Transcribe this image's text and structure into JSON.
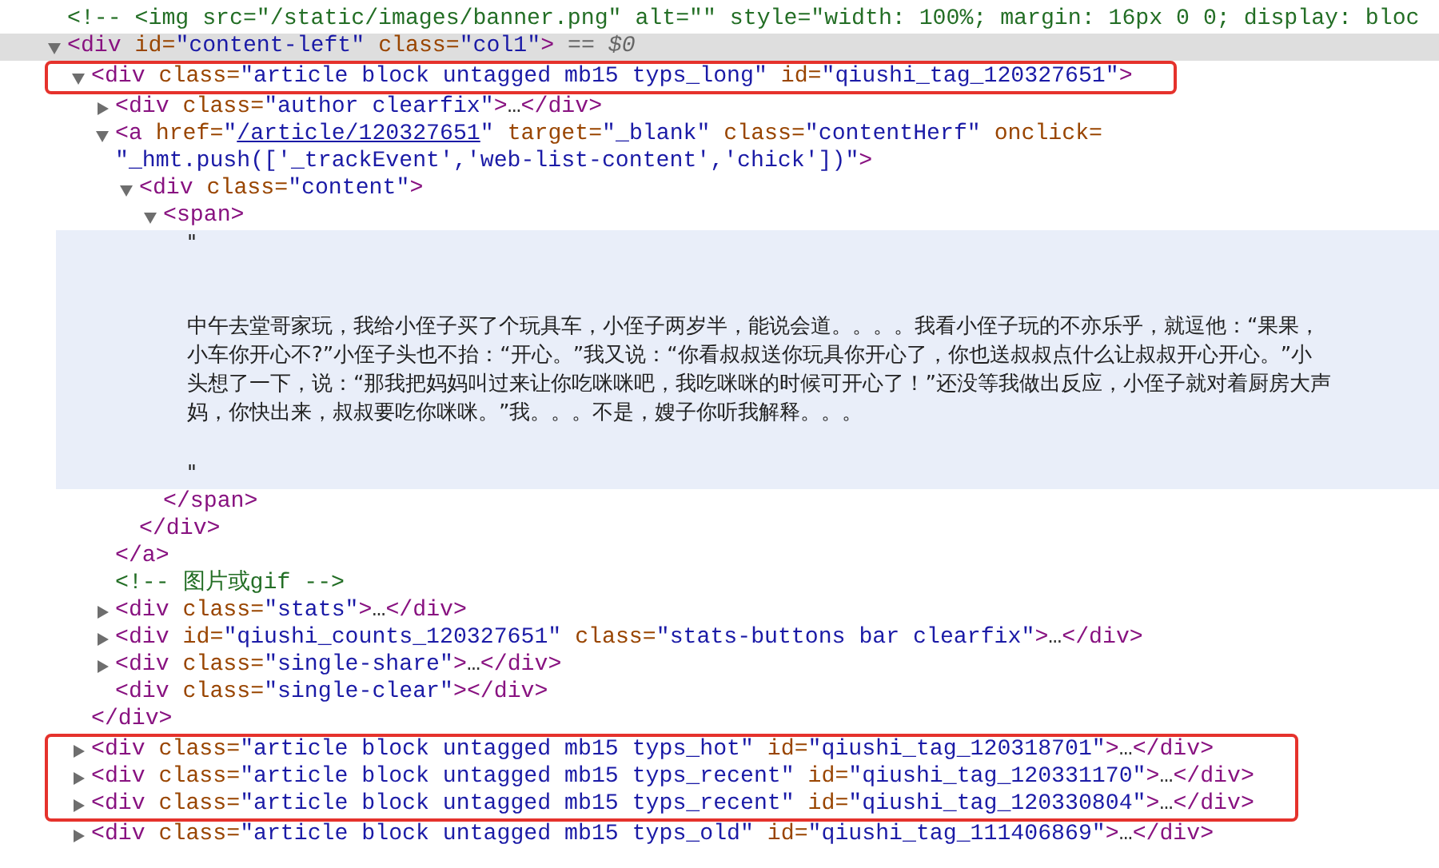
{
  "dom_tree": {
    "nodes": [
      {
        "kind": "comment",
        "selected": false,
        "outlined": false,
        "hovered": false,
        "lines": [
          [
            {
              "kind": "comment",
              "text": "<!-- <img src=\"/static/images/banner.png\" alt=\"\" style=\"width: 100%; margin: 16px 0 0; display: bloc"
            }
          ]
        ]
      },
      {
        "kind": "element",
        "expanded": true,
        "selected": true,
        "outlined": false,
        "hovered": false,
        "lines": [
          [
            {
              "kind": "tag",
              "text": "<div"
            },
            {
              "kind": "attr",
              "text": " id="
            },
            {
              "kind": "value",
              "text": "\"content-left\""
            },
            {
              "kind": "attr",
              "text": " class="
            },
            {
              "kind": "value",
              "text": "\"col1\""
            },
            {
              "kind": "tag",
              "text": ">"
            },
            {
              "kind": "marker",
              "text": " == $0"
            }
          ]
        ],
        "children": [
          {
            "kind": "element",
            "expanded": true,
            "selected": false,
            "outlined": true,
            "hovered": false,
            "lines": [
              [
                {
                  "kind": "tag",
                  "text": "<div"
                },
                {
                  "kind": "attr",
                  "text": " class="
                },
                {
                  "kind": "value",
                  "text": "\"article block untagged mb15 typs_long\""
                },
                {
                  "kind": "attr",
                  "text": " id="
                },
                {
                  "kind": "value",
                  "text": "\"qiushi_tag_120327651\""
                },
                {
                  "kind": "tag",
                  "text": ">"
                }
              ]
            ],
            "close": [
              [
                {
                  "kind": "tag",
                  "text": "</div>"
                }
              ]
            ],
            "children": [
              {
                "kind": "element",
                "expanded": false,
                "selected": false,
                "outlined": false,
                "hovered": false,
                "lines": [
                  [
                    {
                      "kind": "tag",
                      "text": "<div"
                    },
                    {
                      "kind": "attr",
                      "text": " class="
                    },
                    {
                      "kind": "value",
                      "text": "\"author clearfix\""
                    },
                    {
                      "kind": "tag",
                      "text": ">"
                    },
                    {
                      "kind": "ellipsis",
                      "text": "…"
                    },
                    {
                      "kind": "tag",
                      "text": "</div>"
                    }
                  ]
                ]
              },
              {
                "kind": "element",
                "expanded": true,
                "selected": false,
                "outlined": false,
                "hovered": false,
                "lines": [
                  [
                    {
                      "kind": "tag",
                      "text": "<a"
                    },
                    {
                      "kind": "attr",
                      "text": " href="
                    },
                    {
                      "kind": "value",
                      "text": "\""
                    },
                    {
                      "kind": "link",
                      "text": "/article/120327651"
                    },
                    {
                      "kind": "value",
                      "text": "\""
                    },
                    {
                      "kind": "attr",
                      "text": " target="
                    },
                    {
                      "kind": "value",
                      "text": "\"_blank\""
                    },
                    {
                      "kind": "attr",
                      "text": " class="
                    },
                    {
                      "kind": "value",
                      "text": "\"contentHerf\""
                    },
                    {
                      "kind": "attr",
                      "text": " onclick="
                    }
                  ],
                  [
                    {
                      "kind": "value",
                      "text": "\"_hmt.push(['_trackEvent','web-list-content','chick'])\""
                    },
                    {
                      "kind": "tag",
                      "text": ">"
                    }
                  ]
                ],
                "close": [
                  [
                    {
                      "kind": "tag",
                      "text": "</a>"
                    }
                  ]
                ],
                "children": [
                  {
                    "kind": "element",
                    "expanded": true,
                    "selected": false,
                    "outlined": false,
                    "hovered": false,
                    "lines": [
                      [
                        {
                          "kind": "tag",
                          "text": "<div"
                        },
                        {
                          "kind": "attr",
                          "text": " class="
                        },
                        {
                          "kind": "value",
                          "text": "\"content\""
                        },
                        {
                          "kind": "tag",
                          "text": ">"
                        }
                      ]
                    ],
                    "close": [
                      [
                        {
                          "kind": "tag",
                          "text": "</div>"
                        }
                      ]
                    ],
                    "children": [
                      {
                        "kind": "element",
                        "expanded": true,
                        "selected": false,
                        "outlined": false,
                        "hovered": false,
                        "lines": [
                          [
                            {
                              "kind": "tag",
                              "text": "<span>"
                            }
                          ]
                        ],
                        "close": [
                          [
                            {
                              "kind": "tag",
                              "text": "</span>"
                            }
                          ]
                        ],
                        "children": [
                          {
                            "kind": "text",
                            "selected": false,
                            "outlined": false,
                            "hovered": true,
                            "lines": [
                              "\"",
                              "中午去堂哥家玩，我给小侄子买了个玩具车，小侄子两岁半，能说会道。。。。我看小侄子玩的不亦乐乎，就逗他：“果果，",
                              "小车你开心不?”小侄子头也不抬：“开心。”我又说：“你看叔叔送你玩具你开心了，你也送叔叔点什么让叔叔开心开心。”小",
                              "头想了一下，说：“那我把妈妈叫过来让你吃咪咪吧，我吃咪咪的时候可开心了！”还没等我做出反应，小侄子就对着厨房大声",
                              "妈，你快出来，叔叔要吃你咪咪。”我。。。不是，嫂子你听我解释。。。",
                              "\""
                            ]
                          }
                        ]
                      }
                    ]
                  }
                ]
              },
              {
                "kind": "comment",
                "selected": false,
                "outlined": false,
                "hovered": false,
                "lines": [
                  [
                    {
                      "kind": "comment",
                      "text": "<!-- 图片或gif -->"
                    }
                  ]
                ]
              },
              {
                "kind": "element",
                "expanded": false,
                "selected": false,
                "outlined": false,
                "hovered": false,
                "lines": [
                  [
                    {
                      "kind": "tag",
                      "text": "<div"
                    },
                    {
                      "kind": "attr",
                      "text": " class="
                    },
                    {
                      "kind": "value",
                      "text": "\"stats\""
                    },
                    {
                      "kind": "tag",
                      "text": ">"
                    },
                    {
                      "kind": "ellipsis",
                      "text": "…"
                    },
                    {
                      "kind": "tag",
                      "text": "</div>"
                    }
                  ]
                ]
              },
              {
                "kind": "element",
                "expanded": false,
                "selected": false,
                "outlined": false,
                "hovered": false,
                "lines": [
                  [
                    {
                      "kind": "tag",
                      "text": "<div"
                    },
                    {
                      "kind": "attr",
                      "text": " id="
                    },
                    {
                      "kind": "value",
                      "text": "\"qiushi_counts_120327651\""
                    },
                    {
                      "kind": "attr",
                      "text": " class="
                    },
                    {
                      "kind": "value",
                      "text": "\"stats-buttons bar clearfix\""
                    },
                    {
                      "kind": "tag",
                      "text": ">"
                    },
                    {
                      "kind": "ellipsis",
                      "text": "…"
                    },
                    {
                      "kind": "tag",
                      "text": "</div>"
                    }
                  ]
                ]
              },
              {
                "kind": "element",
                "expanded": false,
                "selected": false,
                "outlined": false,
                "hovered": false,
                "lines": [
                  [
                    {
                      "kind": "tag",
                      "text": "<div"
                    },
                    {
                      "kind": "attr",
                      "text": " class="
                    },
                    {
                      "kind": "value",
                      "text": "\"single-share\""
                    },
                    {
                      "kind": "tag",
                      "text": ">"
                    },
                    {
                      "kind": "ellipsis",
                      "text": "…"
                    },
                    {
                      "kind": "tag",
                      "text": "</div>"
                    }
                  ]
                ]
              },
              {
                "kind": "leaf",
                "selected": false,
                "outlined": false,
                "hovered": false,
                "lines": [
                  [
                    {
                      "kind": "tag",
                      "text": "<div"
                    },
                    {
                      "kind": "attr",
                      "text": " class="
                    },
                    {
                      "kind": "value",
                      "text": "\"single-clear\""
                    },
                    {
                      "kind": "tag",
                      "text": "></div>"
                    }
                  ]
                ]
              }
            ]
          },
          {
            "kind": "element",
            "expanded": false,
            "selected": false,
            "outlined": true,
            "hovered": false,
            "lines": [
              [
                {
                  "kind": "tag",
                  "text": "<div"
                },
                {
                  "kind": "attr",
                  "text": " class="
                },
                {
                  "kind": "value",
                  "text": "\"article block untagged mb15 typs_hot\""
                },
                {
                  "kind": "attr",
                  "text": " id="
                },
                {
                  "kind": "value",
                  "text": "\"qiushi_tag_120318701\""
                },
                {
                  "kind": "tag",
                  "text": ">"
                },
                {
                  "kind": "ellipsis",
                  "text": "…"
                },
                {
                  "kind": "tag",
                  "text": "</div>"
                }
              ]
            ]
          },
          {
            "kind": "element",
            "expanded": false,
            "selected": false,
            "outlined": true,
            "hovered": false,
            "lines": [
              [
                {
                  "kind": "tag",
                  "text": "<div"
                },
                {
                  "kind": "attr",
                  "text": " class="
                },
                {
                  "kind": "value",
                  "text": "\"article block untagged mb15 typs_recent\""
                },
                {
                  "kind": "attr",
                  "text": " id="
                },
                {
                  "kind": "value",
                  "text": "\"qiushi_tag_120331170\""
                },
                {
                  "kind": "tag",
                  "text": ">"
                },
                {
                  "kind": "ellipsis",
                  "text": "…"
                },
                {
                  "kind": "tag",
                  "text": "</div>"
                }
              ]
            ]
          },
          {
            "kind": "element",
            "expanded": false,
            "selected": false,
            "outlined": true,
            "hovered": false,
            "lines": [
              [
                {
                  "kind": "tag",
                  "text": "<div"
                },
                {
                  "kind": "attr",
                  "text": " class="
                },
                {
                  "kind": "value",
                  "text": "\"article block untagged mb15 typs_recent\""
                },
                {
                  "kind": "attr",
                  "text": " id="
                },
                {
                  "kind": "value",
                  "text": "\"qiushi_tag_120330804\""
                },
                {
                  "kind": "tag",
                  "text": ">"
                },
                {
                  "kind": "ellipsis",
                  "text": "…"
                },
                {
                  "kind": "tag",
                  "text": "</div>"
                }
              ]
            ]
          },
          {
            "kind": "element",
            "expanded": false,
            "selected": false,
            "outlined": false,
            "hovered": false,
            "lines": [
              [
                {
                  "kind": "tag",
                  "text": "<div"
                },
                {
                  "kind": "attr",
                  "text": " class="
                },
                {
                  "kind": "value",
                  "text": "\"article block untagged mb15 typs_old\""
                },
                {
                  "kind": "attr",
                  "text": " id="
                },
                {
                  "kind": "value",
                  "text": "\"qiushi_tag_111406869\""
                },
                {
                  "kind": "tag",
                  "text": ">"
                },
                {
                  "kind": "ellipsis",
                  "text": "…"
                },
                {
                  "kind": "tag",
                  "text": "</div>"
                }
              ]
            ]
          }
        ]
      }
    ]
  }
}
